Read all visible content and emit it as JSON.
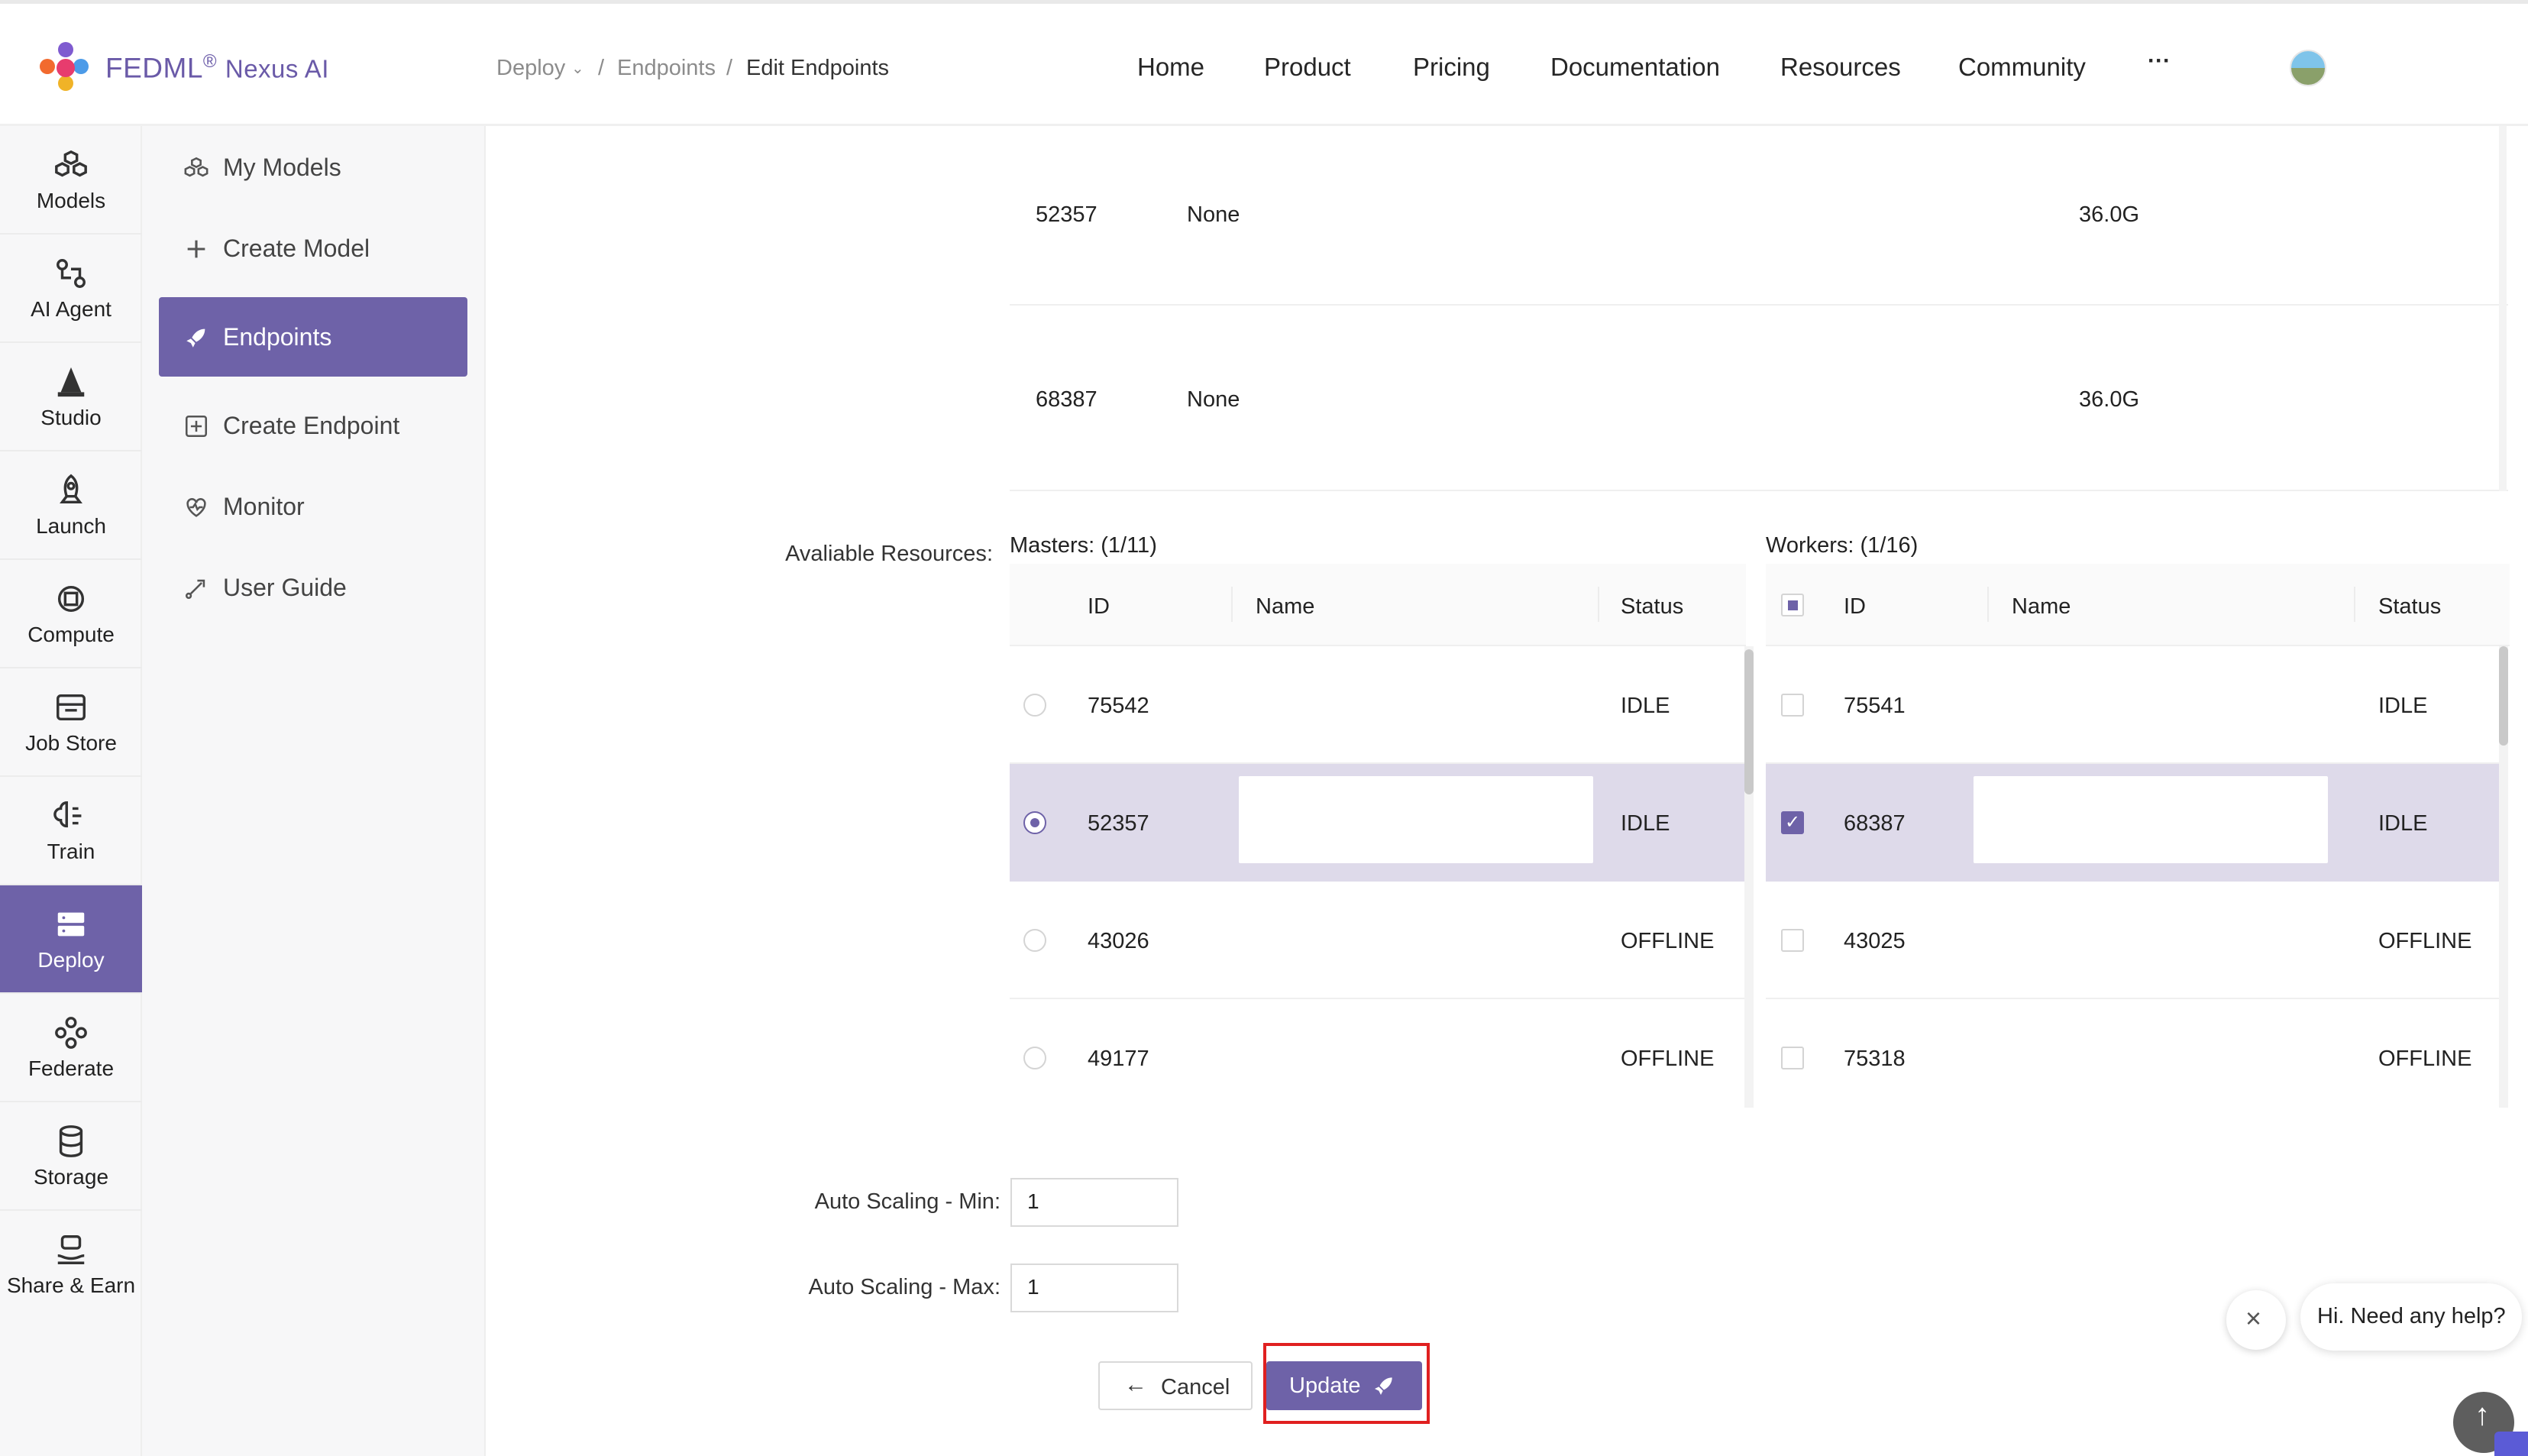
{
  "brand": {
    "name": "FEDML",
    "reg": "®",
    "product": "Nexus AI"
  },
  "breadcrumb": [
    {
      "label": "Deploy"
    },
    {
      "label": "Endpoints"
    },
    {
      "label": "Edit Endpoints"
    }
  ],
  "breadcrumb_sep": "/",
  "nav": [
    "Home",
    "Product",
    "Pricing",
    "Documentation",
    "Resources",
    "Community"
  ],
  "nav_more": "···",
  "rail": [
    {
      "label": "Models",
      "icon": "models-icon"
    },
    {
      "label": "AI Agent",
      "icon": "ai-agent-icon"
    },
    {
      "label": "Studio",
      "icon": "studio-icon"
    },
    {
      "label": "Launch",
      "icon": "rocket-icon"
    },
    {
      "label": "Compute",
      "icon": "chip-icon"
    },
    {
      "label": "Job Store",
      "icon": "store-icon"
    },
    {
      "label": "Train",
      "icon": "brain-icon"
    },
    {
      "label": "Deploy",
      "icon": "server-icon",
      "active": true
    },
    {
      "label": "Federate",
      "icon": "federate-icon"
    },
    {
      "label": "Storage",
      "icon": "database-icon"
    },
    {
      "label": "Share & Earn",
      "icon": "share-earn-icon"
    }
  ],
  "submenu": [
    {
      "label": "My Models",
      "icon": "models-icon"
    },
    {
      "label": "Create Model",
      "icon": "plus-icon"
    },
    {
      "label": "Endpoints",
      "icon": "rocket-icon",
      "active": true
    },
    {
      "label": "Create Endpoint",
      "icon": "plus-square-icon"
    },
    {
      "label": "Monitor",
      "icon": "heart-monitor-icon"
    },
    {
      "label": "User Guide",
      "icon": "guide-icon"
    }
  ],
  "selected_devices": [
    {
      "id": "52357",
      "name": "None",
      "size": "36.0G"
    },
    {
      "id": "68387",
      "name": "None",
      "size": "36.0G"
    }
  ],
  "resources": {
    "label": "Avaliable Resources",
    "masters": {
      "title": "Masters: (1/11)",
      "columns": [
        "ID",
        "Name",
        "Status"
      ],
      "rows": [
        {
          "id": "75542",
          "status": "IDLE",
          "selected": false
        },
        {
          "id": "52357",
          "status": "IDLE",
          "selected": true
        },
        {
          "id": "43026",
          "status": "OFFLINE",
          "selected": false
        },
        {
          "id": "49177",
          "status": "OFFLINE",
          "selected": false
        }
      ]
    },
    "workers": {
      "title": "Workers: (1/16)",
      "columns": [
        "ID",
        "Name",
        "Status"
      ],
      "rows": [
        {
          "id": "75541",
          "status": "IDLE",
          "selected": false
        },
        {
          "id": "68387",
          "status": "IDLE",
          "selected": true
        },
        {
          "id": "43025",
          "status": "OFFLINE",
          "selected": false
        },
        {
          "id": "75318",
          "status": "OFFLINE",
          "selected": false
        }
      ]
    }
  },
  "scaling": {
    "min_label": "Auto Scaling - Min",
    "min_value": "1",
    "max_label": "Auto Scaling - Max",
    "max_value": "1"
  },
  "buttons": {
    "cancel": "Cancel",
    "update": "Update"
  },
  "chat": {
    "text": "Hi. Need any help?"
  },
  "colors": {
    "accent": "#6e62a8",
    "highlight": "#e02020"
  }
}
